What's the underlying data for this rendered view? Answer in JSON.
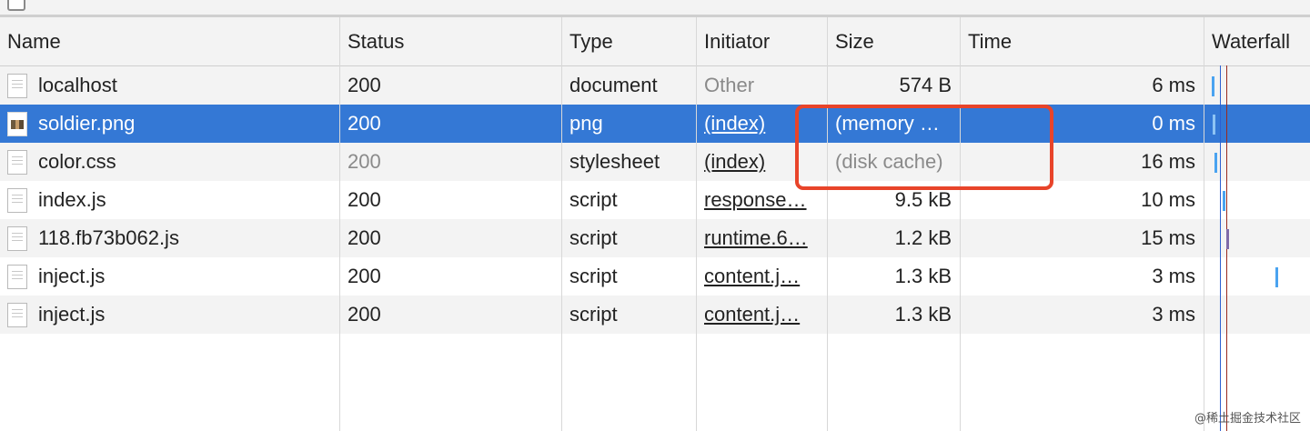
{
  "columns": {
    "name": "Name",
    "status": "Status",
    "type": "Type",
    "initiator": "Initiator",
    "size": "Size",
    "time": "Time",
    "waterfall": "Waterfall"
  },
  "rows": [
    {
      "name": "localhost",
      "icon": "document-file-icon",
      "status": "200",
      "type": "document",
      "initiator": "Other",
      "size": "574 B",
      "time": "6 ms"
    },
    {
      "name": "soldier.png",
      "icon": "image-thumbnail-icon",
      "status": "200",
      "type": "png",
      "initiator": "(index)",
      "size": "(memory …",
      "time": "0 ms",
      "selected": true
    },
    {
      "name": "color.css",
      "icon": "document-file-icon",
      "status": "200",
      "type": "stylesheet",
      "initiator": "(index)",
      "size": "(disk cache)",
      "time": "16 ms"
    },
    {
      "name": "index.js",
      "icon": "document-file-icon",
      "status": "200",
      "type": "script",
      "initiator": "response…",
      "size": "9.5 kB",
      "time": "10 ms"
    },
    {
      "name": "118.fb73b062.js",
      "icon": "document-file-icon",
      "status": "200",
      "type": "script",
      "initiator": "runtime.6…",
      "size": "1.2 kB",
      "time": "15 ms"
    },
    {
      "name": "inject.js",
      "icon": "document-file-icon",
      "status": "200",
      "type": "script",
      "initiator": "content.j…",
      "size": "1.3 kB",
      "time": "3 ms"
    },
    {
      "name": "inject.js",
      "icon": "document-file-icon",
      "status": "200",
      "type": "script",
      "initiator": "content.j…",
      "size": "1.3 kB",
      "time": "3 ms"
    }
  ],
  "colors": {
    "selected_row": "#3478d5",
    "annotation": "#e8442a",
    "waterfall_bar": "#4aa3f0",
    "dom_content_loaded_line": "#2c5fd1",
    "load_line": "#9b2a1f"
  },
  "watermark": "@稀土掘金技术社区"
}
